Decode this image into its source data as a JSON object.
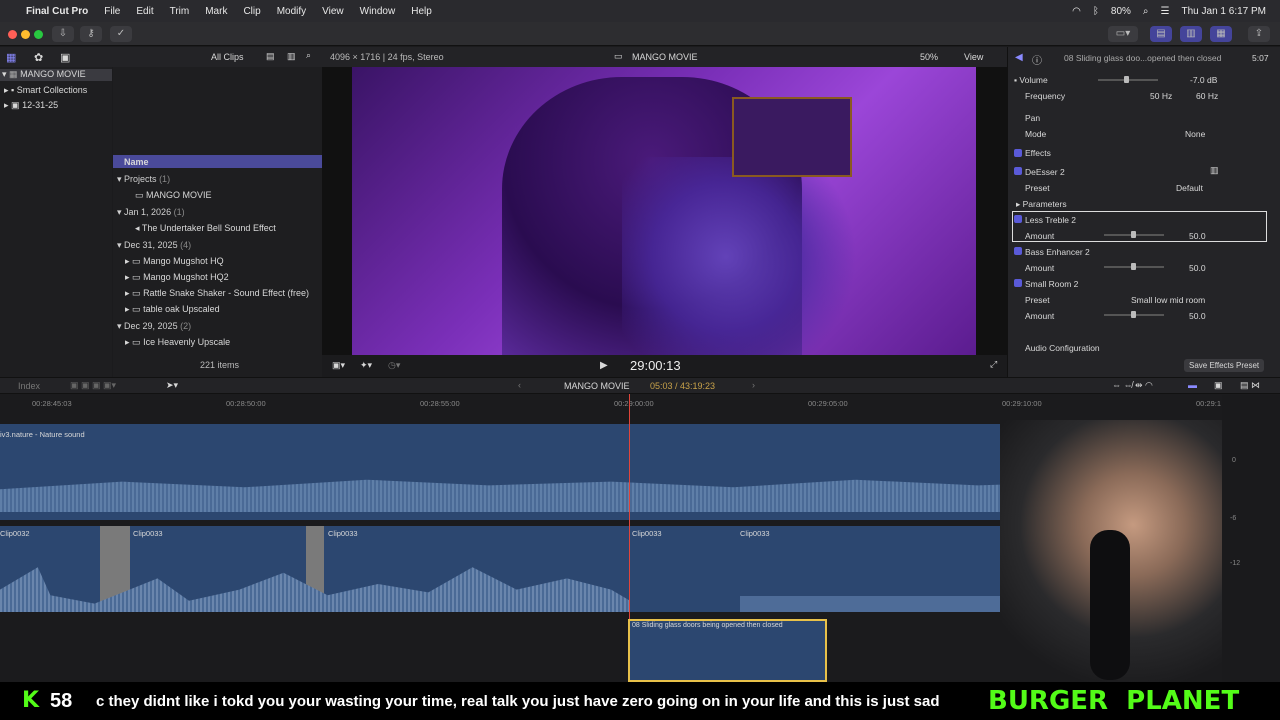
{
  "menubar": {
    "app": "Final Cut Pro",
    "items": [
      "File",
      "Edit",
      "Trim",
      "Mark",
      "Clip",
      "Modify",
      "View",
      "Window",
      "Help"
    ],
    "battery": "80%",
    "clock": "Thu Jan 1  6:17 PM"
  },
  "browser": {
    "filter": "All Clips",
    "library": "MANGO MOVIE",
    "smart_collections": "Smart Collections",
    "event": "12-31-25",
    "name_header": "Name",
    "items_count": "221 items",
    "groups": [
      {
        "title": "Projects",
        "count": "(1)",
        "items": [
          "MANGO MOVIE"
        ]
      },
      {
        "title": "Jan 1, 2026",
        "count": "(1)",
        "items": [
          "The Undertaker Bell  Sound Effect"
        ]
      },
      {
        "title": "Dec 31, 2025",
        "count": "(4)",
        "items": [
          "Mango Mugshot HQ",
          "Mango Mugshot HQ2",
          "Rattle Snake Shaker - Sound Effect (free)",
          "table oak Upscaled"
        ]
      },
      {
        "title": "Dec 29, 2025",
        "count": "(2)",
        "items": [
          "Ice Heavenly Upscale"
        ]
      }
    ]
  },
  "viewer": {
    "format": "4096 × 1716 | 24 fps, Stereo",
    "title": "MANGO MOVIE",
    "zoom": "50%",
    "view": "View",
    "timecode": "29:00:13"
  },
  "inspector": {
    "clip_title": "08 Sliding glass doo...opened then closed",
    "duration": "5:07",
    "volume_label": "Volume",
    "volume_value": "-7.0 dB",
    "frequency_label": "Frequency",
    "freq1": "50 Hz",
    "freq2": "60 Hz",
    "pan_label": "Pan",
    "mode_label": "Mode",
    "mode_value": "None",
    "effects_label": "Effects",
    "deesser": "DeEsser 2",
    "preset_label": "Preset",
    "preset_default": "Default",
    "parameters": "Parameters",
    "less_treble": "Less Treble 2",
    "amount_label": "Amount",
    "amount1": "50.0",
    "bass": "Bass Enhancer 2",
    "amount2": "50.0",
    "small_room": "Small Room 2",
    "preset2": "Small low mid room",
    "amount3": "50.0",
    "audio_config": "Audio Configuration",
    "save_preset": "Save Effects Preset",
    "amount_levels": [
      0.5,
      0.5,
      0.5
    ]
  },
  "timeline": {
    "index": "Index",
    "project": "MANGO MOVIE",
    "position": "05:03 / 43:19:23",
    "ruler": [
      "00:28:45:03",
      "00:28:50:00",
      "00:28:55:00",
      "00:29:00:00",
      "00:29:05:00",
      "00:29:10:00",
      "00:29:1"
    ],
    "nature_track": "iv3.nature - Nature sound",
    "clips": [
      "Clip0032",
      "Clip0033",
      "Clip0033",
      "Clip0033",
      "Clip0033"
    ],
    "sfx_clip": "08 Sliding glass doors being opened then closed",
    "meter_labels": [
      "0",
      "-6",
      "-12"
    ]
  },
  "stream": {
    "kick_count": "58",
    "ticker": "c they didnt like i tokd you your wasting your time, real talk you just have zero going on in your life and this is just sad",
    "brand": "BURGER  PLANET"
  }
}
